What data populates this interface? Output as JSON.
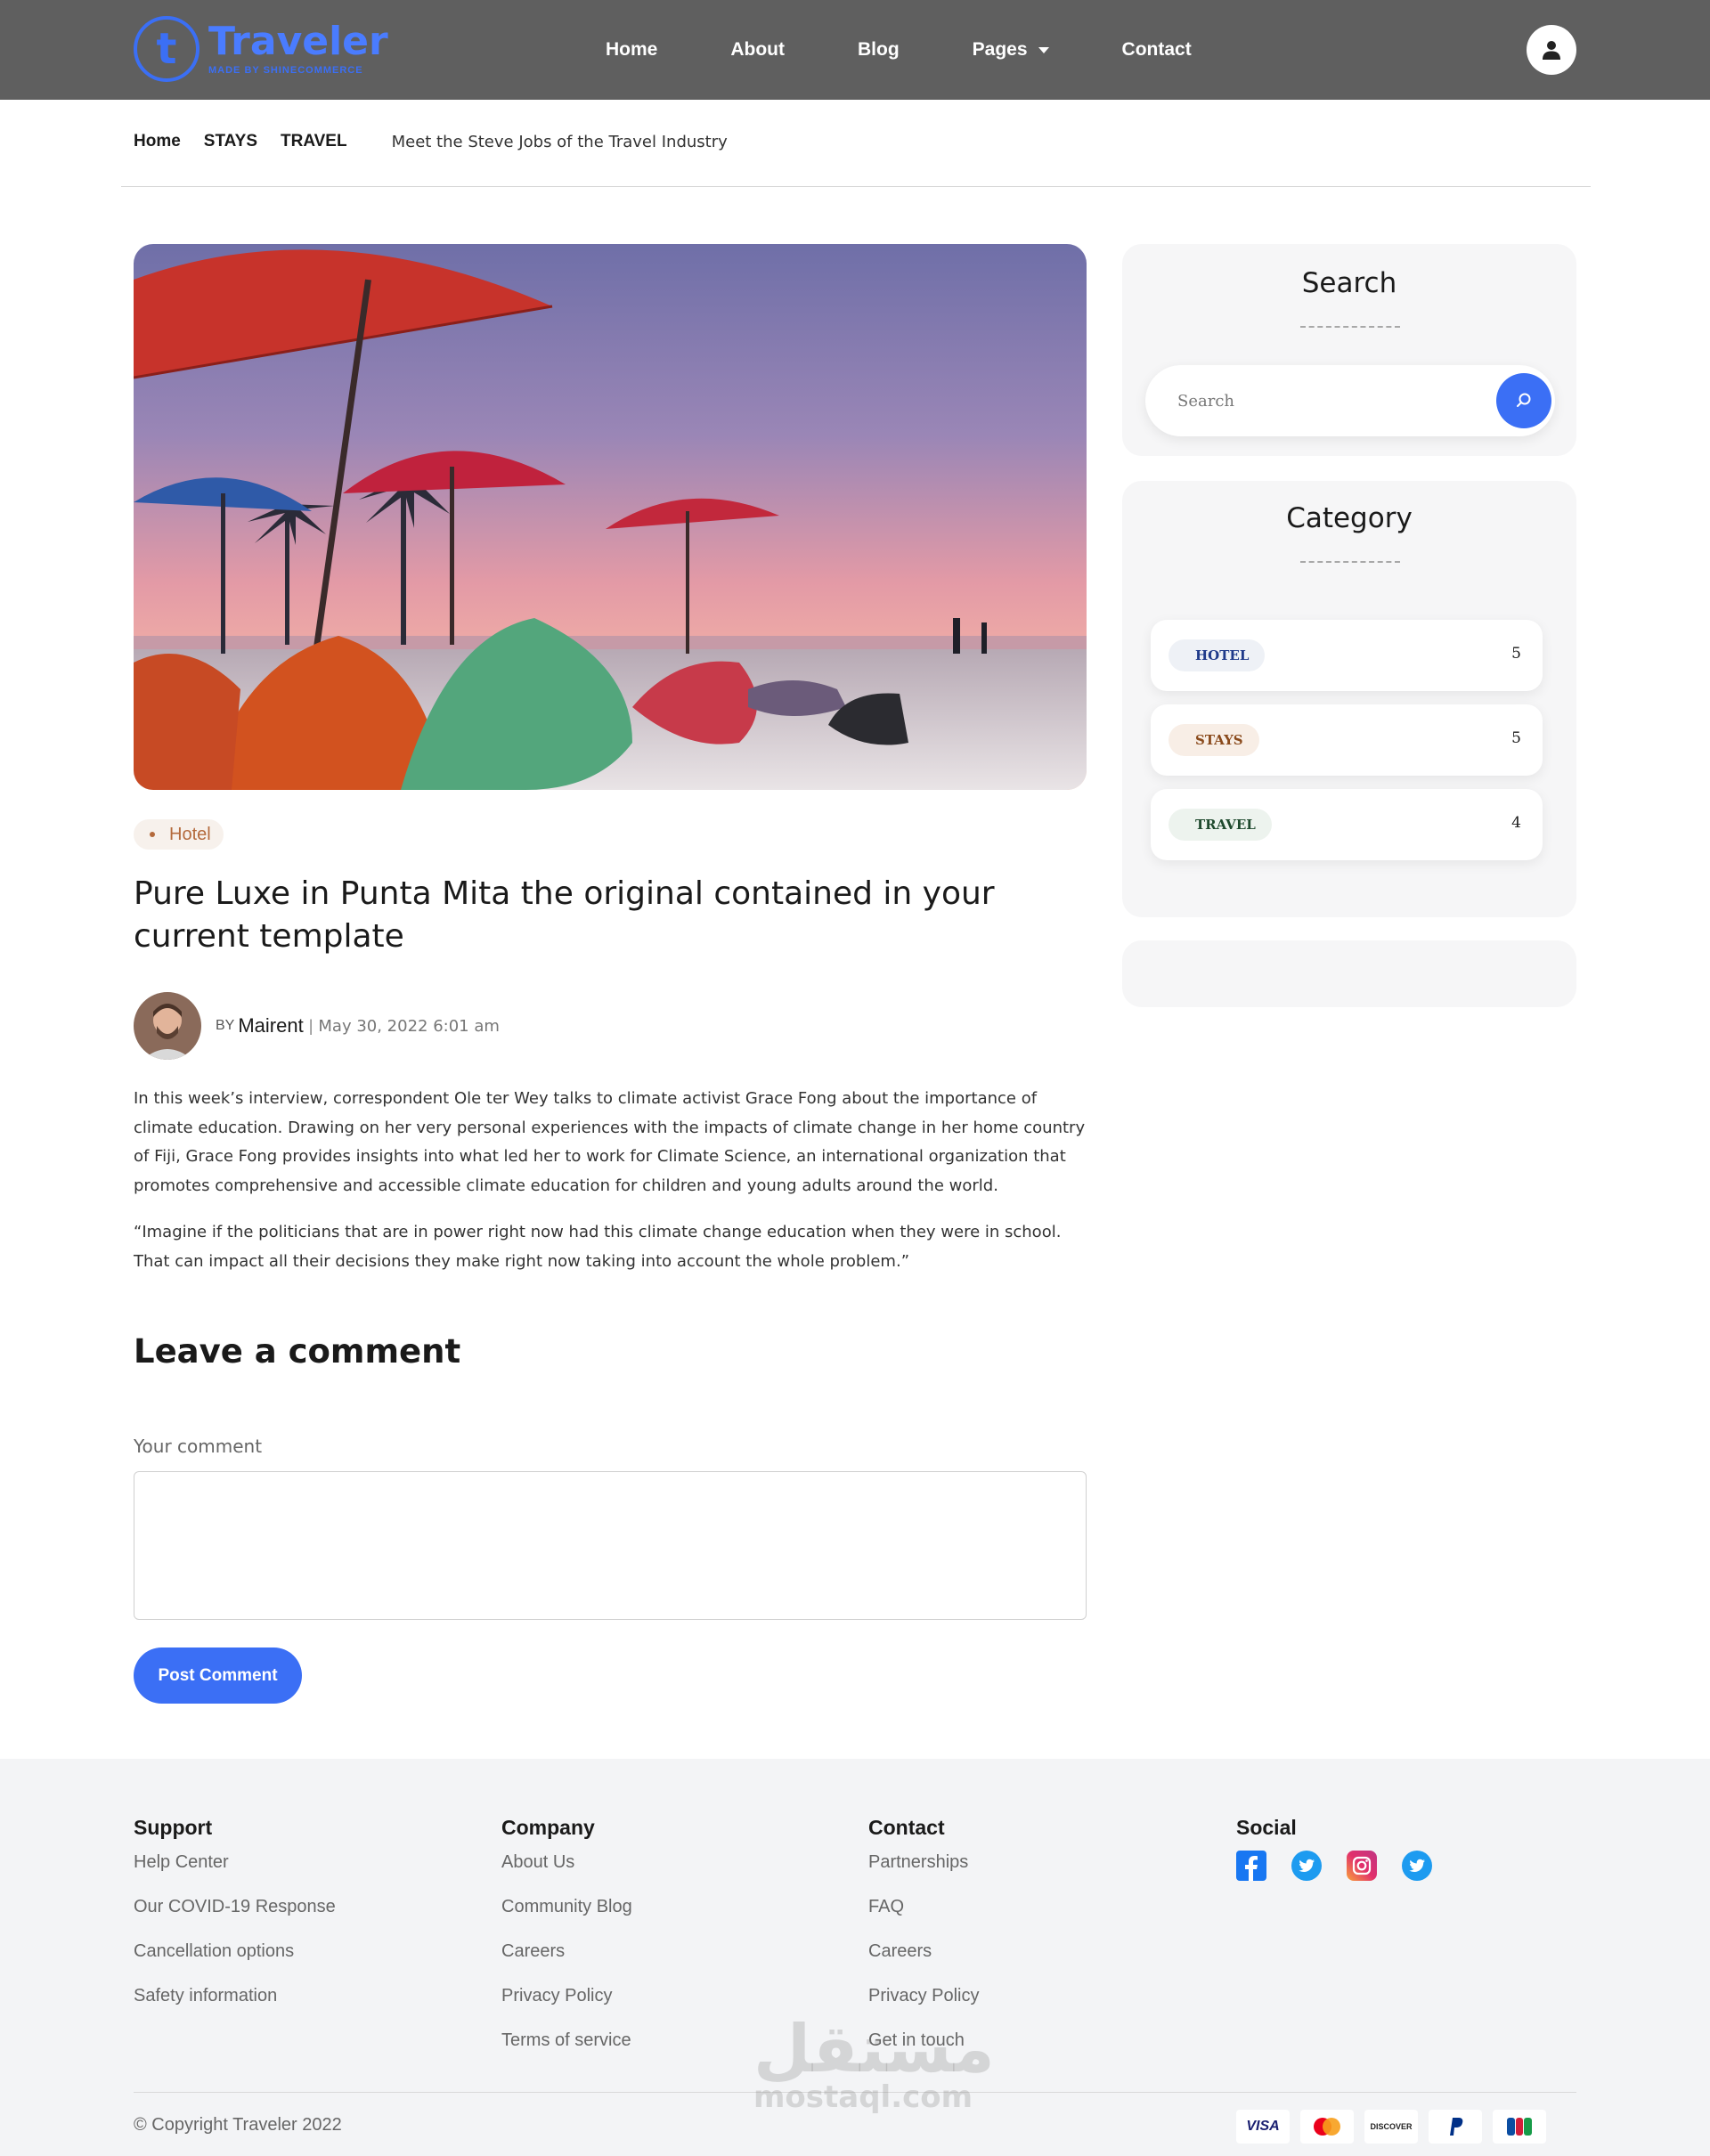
{
  "header": {
    "logo_name": "Traveler",
    "logo_tagline": "MADE BY SHINECOMMERCE",
    "nav": [
      "Home",
      "About",
      "Blog",
      "Pages",
      "Contact"
    ]
  },
  "breadcrumb": {
    "items": [
      "Home",
      "STAYS",
      "TRAVEL"
    ],
    "current": "Meet the Steve Jobs of the Travel Industry"
  },
  "post": {
    "tag": "Hotel",
    "title": "Pure Luxe in Punta Mita the original contained in your current template",
    "by_label": "BY",
    "author": "Mairent",
    "separator": "|",
    "date": "May 30, 2022 6:01 am",
    "paragraphs": [
      "In this week’s interview, correspondent Ole ter Wey talks to climate activist Grace Fong about the importance of climate education. Drawing on her very personal experiences with the impacts of climate change in her home country of Fiji, Grace Fong provides insights into what led her to work for Climate Science, an international organization that promotes comprehensive and accessible climate education for children and young adults around the world.",
      "“Imagine if the politicians that are in power right now had this climate change education when they were in school. That can impact all their decisions they make right now taking into account the whole problem.”"
    ]
  },
  "comment": {
    "heading": "Leave a comment",
    "label": "Your comment",
    "button": "Post Comment"
  },
  "sidebar": {
    "search": {
      "title": "Search",
      "placeholder": "Search"
    },
    "category": {
      "title": "Category",
      "items": [
        {
          "label": "HOTEL",
          "count": "5",
          "color": "#1f3a8a",
          "bg": "#eef1f6"
        },
        {
          "label": "STAYS",
          "count": "5",
          "color": "#8a4a1c",
          "bg": "#f8eee6"
        },
        {
          "label": "TRAVEL",
          "count": "4",
          "color": "#1f4a2e",
          "bg": "#edf3ee"
        }
      ]
    }
  },
  "footer": {
    "columns": [
      {
        "title": "Support",
        "links": [
          "Help Center",
          "Our COVID-19 Response",
          "Cancellation options",
          "Safety information"
        ]
      },
      {
        "title": "Company",
        "links": [
          "About Us",
          "Community Blog",
          "Careers",
          "Privacy Policy",
          "Terms of service"
        ]
      },
      {
        "title": "Contact",
        "links": [
          "Partnerships",
          "FAQ",
          "Careers",
          "Privacy Policy",
          "Get in touch"
        ]
      }
    ],
    "social_title": "Social",
    "social_icons": [
      "facebook-icon",
      "twitter-icon",
      "instagram-icon",
      "twitter-icon"
    ],
    "copyright": "© Copyright Traveler 2022",
    "payments": [
      "VISA",
      "mastercard-icon",
      "DISCOVER",
      "paypal-icon",
      "jcb-icon"
    ]
  },
  "watermark": {
    "arabic": "مستقل",
    "latin": "mostaql.com"
  },
  "colors": {
    "accent": "#3b6ff5",
    "header_bg": "#5f5f5f",
    "tag_text": "#b46a3c"
  }
}
